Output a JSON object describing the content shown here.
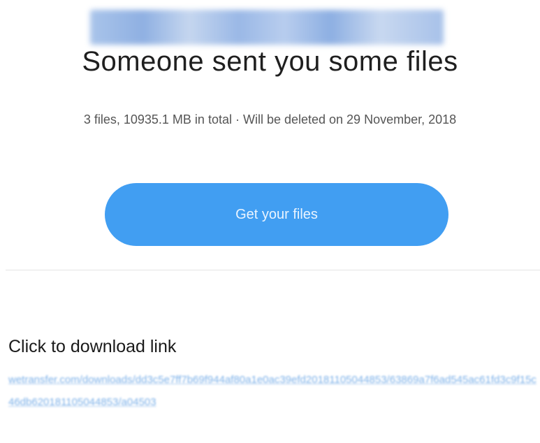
{
  "email": {
    "title": "Someone sent you some files",
    "subtitle": "3 files, 10935.1 MB in total · Will be deleted on 29 November, 2018",
    "cta_label": "Get your files",
    "link_heading": "Click to download link",
    "download_link": "wetransfer.com/downloads/dd3c5e7ff7b69f944af80a1e0ac39efd20181105044853/63869a7f6ad545ac61fd3c9f15c46db620181105044853/a04503"
  },
  "colors": {
    "button": "#419ef2",
    "link": "#6ea8e6",
    "banner": "#9ab8e6"
  }
}
